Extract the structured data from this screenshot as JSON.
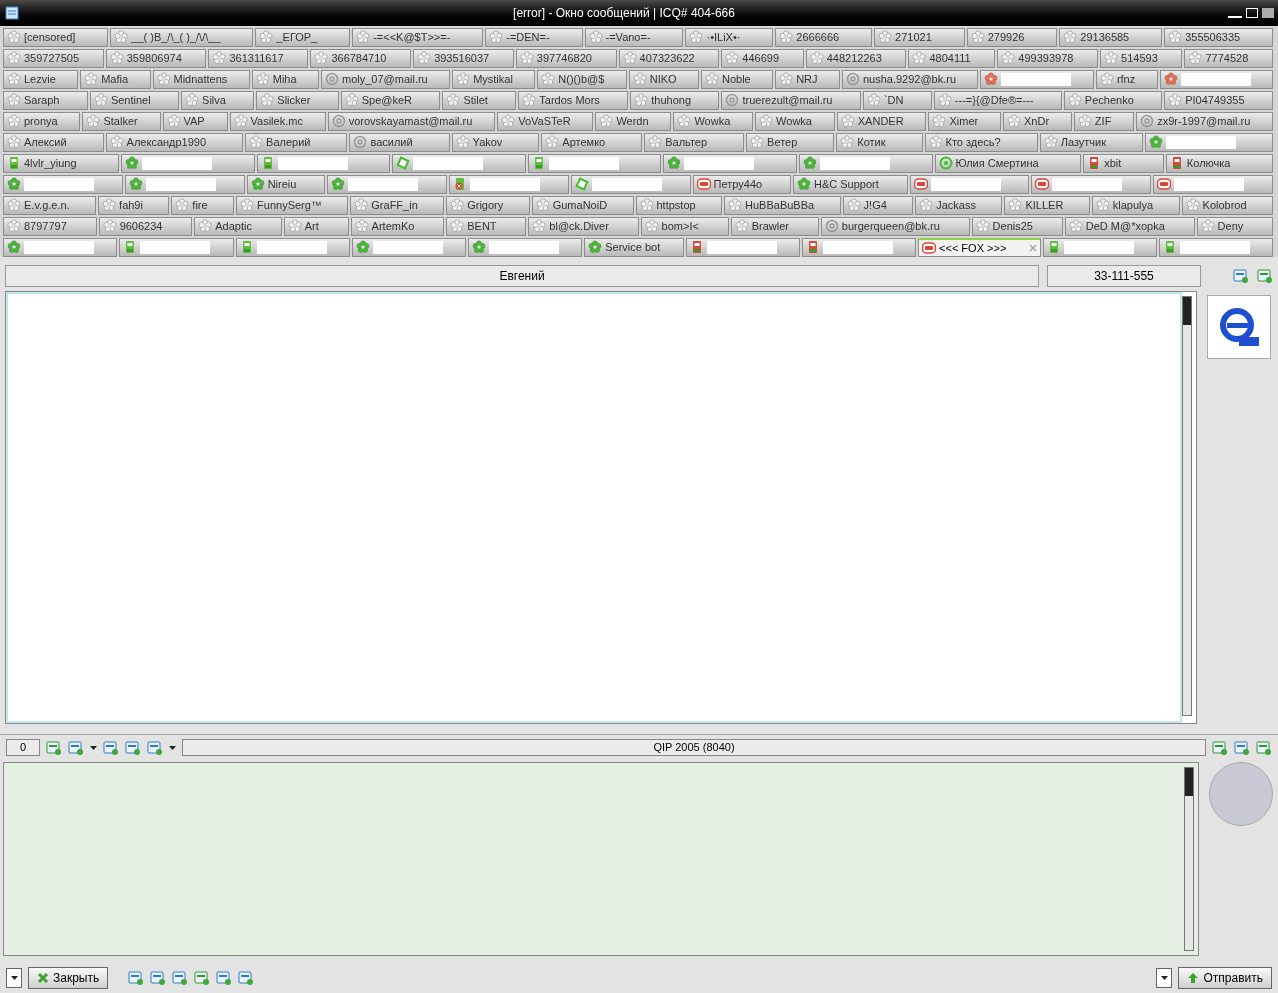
{
  "window": {
    "title": "[error] - Окно сообщений | ICQ# 404-666"
  },
  "tab_rows": [
    [
      {
        "label": "[censored]",
        "kind": "offline",
        "selected": false
      },
      {
        "label": "__( )B_/\\_( )_/\\/\\__",
        "kind": "offline",
        "selected": false
      },
      {
        "label": "_ЕГОР_",
        "kind": "offline",
        "selected": false
      },
      {
        "label": "-=<<K@$T>>=-",
        "kind": "offline",
        "selected": false
      },
      {
        "label": "-=DEN=-",
        "kind": "offline",
        "selected": false
      },
      {
        "label": "-=Vano=-",
        "kind": "offline",
        "selected": false
      },
      {
        "label": "·•ILiX•·",
        "kind": "offline",
        "selected": false
      },
      {
        "label": "2666666",
        "kind": "offline",
        "selected": false
      },
      {
        "label": "271021",
        "kind": "offline",
        "selected": false
      },
      {
        "label": "279926",
        "kind": "offline",
        "selected": false
      },
      {
        "label": "29136585",
        "kind": "offline",
        "selected": false
      },
      {
        "label": "355506335",
        "kind": "offline",
        "selected": false
      }
    ],
    [
      {
        "label": "359727505",
        "kind": "offline",
        "selected": false
      },
      {
        "label": "359806974",
        "kind": "offline",
        "selected": false
      },
      {
        "label": "361311617",
        "kind": "offline",
        "selected": false
      },
      {
        "label": "366784710",
        "kind": "offline",
        "selected": false
      },
      {
        "label": "393516037",
        "kind": "offline",
        "selected": false
      },
      {
        "label": "397746820",
        "kind": "offline",
        "selected": false
      },
      {
        "label": "407323622",
        "kind": "offline",
        "selected": false
      },
      {
        "label": "446699",
        "kind": "offline",
        "selected": false
      },
      {
        "label": "448212263",
        "kind": "offline",
        "selected": false
      },
      {
        "label": "4804111",
        "kind": "offline",
        "selected": false
      },
      {
        "label": "499393978",
        "kind": "offline",
        "selected": false
      },
      {
        "label": "514593",
        "kind": "offline",
        "selected": false
      },
      {
        "label": "7774528",
        "kind": "offline",
        "selected": false
      }
    ],
    [
      {
        "label": "Lezvie",
        "kind": "offline",
        "selected": false
      },
      {
        "label": "Mafia",
        "kind": "offline",
        "selected": false
      },
      {
        "label": "Midnattens",
        "kind": "offline",
        "selected": false
      },
      {
        "label": "Miha",
        "kind": "offline",
        "selected": false
      },
      {
        "label": "moly_07@mail.ru",
        "kind": "mail",
        "selected": false
      },
      {
        "label": "Mystikal",
        "kind": "offline",
        "selected": false
      },
      {
        "label": "N()()b@$",
        "kind": "offline",
        "selected": false
      },
      {
        "label": "NIKO",
        "kind": "offline",
        "selected": false
      },
      {
        "label": "Noble",
        "kind": "offline",
        "selected": false
      },
      {
        "label": "NRJ",
        "kind": "offline",
        "selected": false
      },
      {
        "label": "nusha.9292@bk.ru",
        "kind": "mail",
        "selected": false
      },
      {
        "kind": "away",
        "redacted": true,
        "selected": false
      },
      {
        "label": "rfnz",
        "kind": "offline",
        "selected": false
      },
      {
        "kind": "away",
        "redacted": true,
        "selected": false
      }
    ],
    [
      {
        "label": "Saraph",
        "kind": "offline",
        "selected": false
      },
      {
        "label": "Sentinel",
        "kind": "offline",
        "selected": false
      },
      {
        "label": "Silva",
        "kind": "offline",
        "selected": false
      },
      {
        "label": "Slicker",
        "kind": "offline",
        "selected": false
      },
      {
        "label": "Spe@keR",
        "kind": "offline",
        "selected": false
      },
      {
        "label": "Stilet",
        "kind": "offline",
        "selected": false
      },
      {
        "label": "Tardos Mors",
        "kind": "offline",
        "selected": false
      },
      {
        "label": "thuhong",
        "kind": "offline",
        "selected": false
      },
      {
        "label": "truerezult@mail.ru",
        "kind": "mail",
        "selected": false
      },
      {
        "label": "`DN",
        "kind": "offline",
        "selected": false
      },
      {
        "label": "---=}{@Dfe®=---",
        "kind": "offline",
        "selected": false
      },
      {
        "label": "Pechenko",
        "kind": "offline",
        "selected": false
      },
      {
        "label": "PI04749355",
        "kind": "offline",
        "selected": false
      }
    ],
    [
      {
        "label": "pronya",
        "kind": "offline",
        "selected": false
      },
      {
        "label": "Stalker",
        "kind": "offline",
        "selected": false
      },
      {
        "label": "VAP",
        "kind": "offline",
        "selected": false
      },
      {
        "label": "Vasilek.mc",
        "kind": "offline",
        "selected": false
      },
      {
        "label": "vorovskayamast@mail.ru",
        "kind": "mail",
        "selected": false
      },
      {
        "label": "VoVaSTeR",
        "kind": "offline",
        "selected": false
      },
      {
        "label": "Werdn",
        "kind": "offline",
        "selected": false
      },
      {
        "label": "Wowka",
        "kind": "offline",
        "selected": false
      },
      {
        "label": "Wowka",
        "kind": "offline",
        "selected": false
      },
      {
        "label": "XANDER",
        "kind": "offline",
        "selected": false
      },
      {
        "label": "Ximer",
        "kind": "offline",
        "selected": false
      },
      {
        "label": "XnDr",
        "kind": "offline",
        "selected": false
      },
      {
        "label": "ZIF",
        "kind": "offline",
        "selected": false
      },
      {
        "label": "zx9r-1997@mail.ru",
        "kind": "mail",
        "selected": false
      }
    ],
    [
      {
        "label": "Алексий",
        "kind": "offline",
        "selected": false
      },
      {
        "label": "Александр1990",
        "kind": "offline",
        "selected": false
      },
      {
        "label": "Валерий",
        "kind": "offline",
        "selected": false
      },
      {
        "label": "василий",
        "kind": "mail",
        "selected": false
      },
      {
        "label": "Yakov",
        "kind": "offline",
        "selected": false
      },
      {
        "label": "Артемко",
        "kind": "offline",
        "selected": false
      },
      {
        "label": "Вальтер",
        "kind": "offline",
        "selected": false
      },
      {
        "label": "Ветер",
        "kind": "offline",
        "selected": false
      },
      {
        "label": "Котик",
        "kind": "offline",
        "selected": false
      },
      {
        "label": "Кто здесь?",
        "kind": "offline",
        "selected": false
      },
      {
        "label": "Лазутчик",
        "kind": "offline",
        "selected": false
      },
      {
        "kind": "online",
        "redacted": true,
        "selected": false
      }
    ],
    [
      {
        "label": "4lvlr_yiung",
        "kind": "mobile",
        "selected": false
      },
      {
        "kind": "online",
        "redacted": true,
        "selected": false
      },
      {
        "kind": "mobile",
        "redacted": true,
        "selected": false
      },
      {
        "kind": "nonauth",
        "redacted": true,
        "selected": false
      },
      {
        "kind": "mobile",
        "redacted": true,
        "selected": false
      },
      {
        "kind": "online",
        "redacted": true,
        "selected": false
      },
      {
        "kind": "online",
        "redacted": true,
        "selected": false
      },
      {
        "label": "Юлия Смертина",
        "kind": "mailonline",
        "selected": false
      },
      {
        "label": "xbit",
        "kind": "mobilebusy",
        "selected": false
      },
      {
        "label": "Колючка",
        "kind": "mobilebusy",
        "selected": false
      }
    ],
    [
      {
        "kind": "online",
        "redacted": true,
        "selected": false
      },
      {
        "kind": "online",
        "redacted": true,
        "selected": false
      },
      {
        "label": "Nireiu",
        "kind": "online",
        "selected": false
      },
      {
        "kind": "online",
        "redacted": true,
        "selected": false
      },
      {
        "kind": "blocked",
        "redacted": true,
        "selected": false
      },
      {
        "kind": "nonauth",
        "redacted": true,
        "selected": false
      },
      {
        "label": "Петру44о",
        "kind": "na",
        "selected": false
      },
      {
        "label": "H&C Support",
        "kind": "online",
        "selected": false
      },
      {
        "kind": "na",
        "redacted": true,
        "selected": false
      },
      {
        "kind": "na",
        "redacted": true,
        "selected": false
      },
      {
        "kind": "na",
        "redacted": true,
        "selected": false
      }
    ],
    [
      {
        "label": "E.v.g.e.n.",
        "kind": "offline",
        "selected": false
      },
      {
        "label": "fah9i",
        "kind": "offline",
        "selected": false
      },
      {
        "label": "fire",
        "kind": "offline",
        "selected": false
      },
      {
        "label": "FunnySerg™",
        "kind": "offline",
        "selected": false
      },
      {
        "label": "GraFF_in",
        "kind": "offline",
        "selected": false
      },
      {
        "label": "Grigory",
        "kind": "offline",
        "selected": false
      },
      {
        "label": "GumaNoiD",
        "kind": "offline",
        "selected": false
      },
      {
        "label": "httpstop",
        "kind": "offline",
        "selected": false
      },
      {
        "label": "HuBBaBuBBa",
        "kind": "offline",
        "selected": false
      },
      {
        "label": "J!G4",
        "kind": "offline",
        "selected": false
      },
      {
        "label": "Jackass",
        "kind": "offline",
        "selected": false
      },
      {
        "label": "KILLER",
        "kind": "offline",
        "selected": false
      },
      {
        "label": "klapulya",
        "kind": "offline",
        "selected": false
      },
      {
        "label": "Kolobrod",
        "kind": "offline",
        "selected": false
      }
    ],
    [
      {
        "label": "8797797",
        "kind": "offline",
        "selected": false
      },
      {
        "label": "9606234",
        "kind": "offline",
        "selected": false
      },
      {
        "label": "Adaptic",
        "kind": "offline",
        "selected": false
      },
      {
        "label": "Art",
        "kind": "offline",
        "selected": false
      },
      {
        "label": "ArtemKo",
        "kind": "offline",
        "selected": false
      },
      {
        "label": "BENT",
        "kind": "offline",
        "selected": false
      },
      {
        "label": "bl@ck.Diver",
        "kind": "offline",
        "selected": false
      },
      {
        "label": "bom>I<",
        "kind": "offline",
        "selected": false
      },
      {
        "label": "Brawler",
        "kind": "offline",
        "selected": false
      },
      {
        "label": "burgerqueen@bk.ru",
        "kind": "mail",
        "selected": false
      },
      {
        "label": "Denis25",
        "kind": "offline",
        "selected": false
      },
      {
        "label": "DeD M@*xopka",
        "kind": "offline",
        "selected": false
      },
      {
        "label": "Deny",
        "kind": "offline",
        "selected": false
      }
    ],
    [
      {
        "kind": "online",
        "redacted": true,
        "selected": false
      },
      {
        "kind": "mobile",
        "redacted": true,
        "selected": false
      },
      {
        "kind": "mobile",
        "redacted": true,
        "selected": false
      },
      {
        "kind": "online",
        "redacted": true,
        "selected": false
      },
      {
        "kind": "online",
        "redacted": true,
        "selected": false
      },
      {
        "label": "Service bot",
        "kind": "online",
        "selected": false
      },
      {
        "kind": "mobilebusy",
        "redacted": true,
        "selected": false
      },
      {
        "kind": "mobilebusy",
        "redacted": true,
        "selected": false
      },
      {
        "label": "<<< FOX >>>",
        "kind": "na",
        "selected": true
      },
      {
        "kind": "mobile",
        "redacted": true,
        "selected": false
      },
      {
        "kind": "mobile",
        "redacted": true,
        "selected": false
      }
    ]
  ],
  "contact_bar": {
    "name": "Евгений",
    "number": "33-111-555"
  },
  "toolbar": {
    "counter": "0",
    "client": "QIP 2005 (8040)"
  },
  "buttons": {
    "close": "Закрыть",
    "send": "Отправить"
  }
}
